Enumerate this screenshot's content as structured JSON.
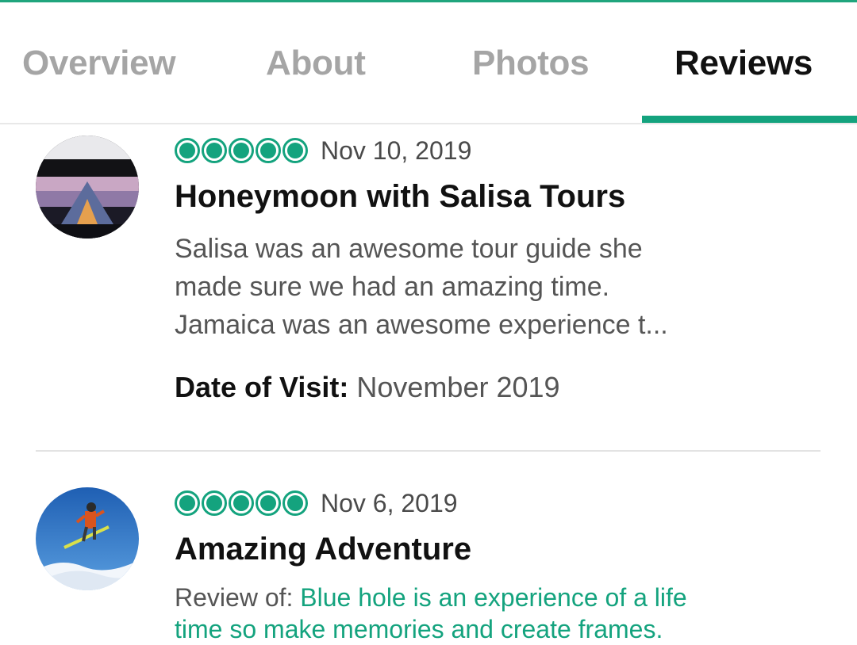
{
  "tabs": [
    {
      "label": "Overview",
      "active": false
    },
    {
      "label": "About",
      "active": false
    },
    {
      "label": "Photos",
      "active": false
    },
    {
      "label": "Reviews",
      "active": true
    }
  ],
  "colors": {
    "accent": "#14a37e",
    "inactive_tab": "#a5a5a5"
  },
  "reviews": [
    {
      "rating": 5,
      "date": "Nov 10, 2019",
      "title": "Honeymoon with Salisa Tours",
      "body_lines": [
        "Salisa was an awesome tour guide she",
        "made sure we had an amazing time.",
        "Jamaica was an awesome experience t..."
      ],
      "date_of_visit_label": "Date of Visit:",
      "date_of_visit": "November 2019",
      "avatar": "tent-at-sunset-avatar"
    },
    {
      "rating": 5,
      "date": "Nov 6, 2019",
      "title": "Amazing Adventure",
      "review_of_label": "Review of:",
      "review_of_lines": [
        "Blue hole is an experience of a life",
        "time so make memories and create frames."
      ],
      "avatar": "skier-jump-avatar"
    }
  ]
}
